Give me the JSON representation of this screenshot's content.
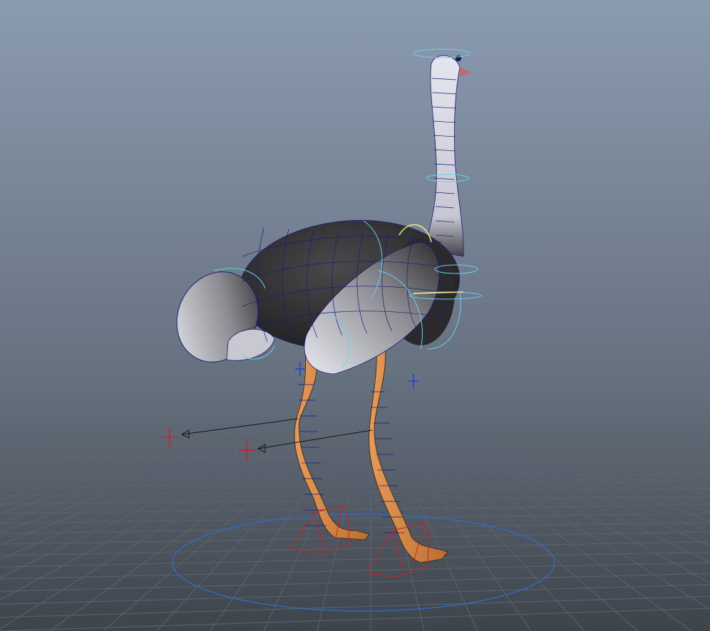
{
  "viewport": {
    "bg_top": "#8b9bb0",
    "bg_bottom": "#3e444c",
    "grid_color": "#5d646c",
    "body_color": "#2a2a2c",
    "wing_color": "#9a9aa0",
    "neck_color": "#d8d8e2",
    "leg_color": "#d48a4c",
    "wire_color": "#1a1a7a",
    "control_cyan": "#6ad0f0",
    "control_red": "#d02020",
    "control_blue": "#2060d0",
    "control_yellow": "#f0f080"
  }
}
